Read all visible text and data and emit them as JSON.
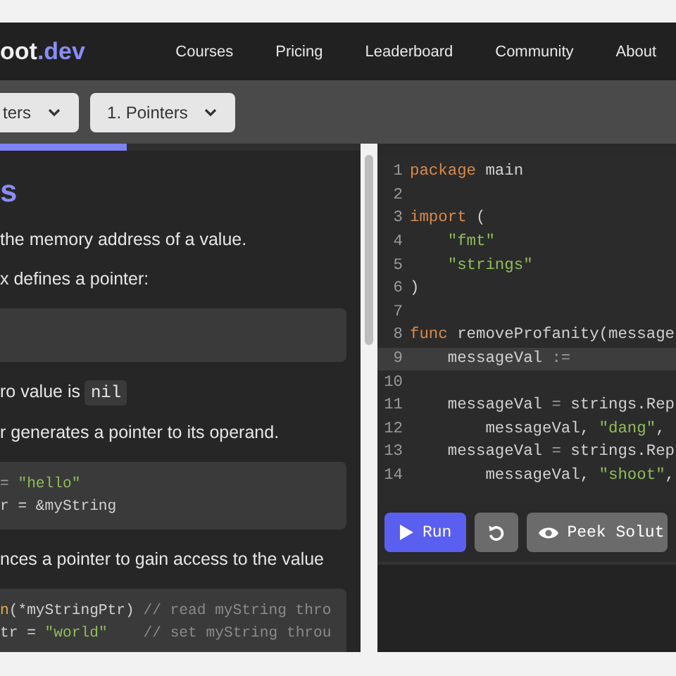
{
  "navbar": {
    "logo": {
      "name": "oot",
      "suffix": ".dev"
    },
    "links": [
      "Courses",
      "Pricing",
      "Leaderboard",
      "Community",
      "About"
    ]
  },
  "breadcrumbs": [
    {
      "label": "ters"
    },
    {
      "label": "1. Pointers"
    }
  ],
  "lesson": {
    "progress": {
      "level": 0.35
    },
    "heading": "s",
    "blocks": [
      {
        "kind": "text",
        "text": "the memory address of a value."
      },
      {
        "kind": "text",
        "text": "x defines a pointer:"
      },
      {
        "kind": "code"
      },
      {
        "kind": "text",
        "text": "ro value is",
        "code": "nil"
      },
      {
        "kind": "text",
        "text": "r generates a pointer to its operand."
      },
      {
        "kind": "code",
        "lines": [
          [
            {
              "text": "= ",
              "kind": "op"
            },
            {
              "text": "\"hello\"",
              "kind": "str"
            }
          ],
          [
            {
              "text": "r = &myString",
              "kind": "plain"
            }
          ]
        ]
      },
      {
        "kind": "text",
        "text": "nces a pointer to gain access to the value"
      },
      {
        "kind": "code",
        "lines": [
          [
            {
              "text": "n",
              "kind": "fn"
            },
            {
              "text": "(*myStringPtr) ",
              "kind": "plain"
            },
            {
              "text": "// read myString thro",
              "kind": "comment"
            }
          ],
          [
            {
              "text": "tr = ",
              "kind": "plain"
            },
            {
              "text": "\"world\"",
              "kind": "str"
            },
            {
              "text": "    // set myString throu",
              "kind": "comment"
            }
          ]
        ]
      }
    ]
  },
  "editor": {
    "lines": [
      {
        "number": "1",
        "active": false,
        "tokens": [
          {
            "text": "package ",
            "kind": "kw"
          },
          {
            "text": "main",
            "kind": "plain"
          }
        ]
      },
      {
        "number": "2",
        "active": false
      },
      {
        "number": "3",
        "active": false,
        "tokens": [
          {
            "text": "import ",
            "kind": "kw"
          },
          {
            "text": "(",
            "kind": "plain"
          }
        ]
      },
      {
        "number": "4",
        "active": false,
        "tokens": [
          {
            "text": "    \"fmt\"",
            "kind": "str"
          }
        ]
      },
      {
        "number": "5",
        "active": false,
        "tokens": [
          {
            "text": "    \"strings\"",
            "kind": "str"
          }
        ]
      },
      {
        "number": "6",
        "active": false,
        "tokens": [
          {
            "text": ")",
            "kind": "plain"
          }
        ]
      },
      {
        "number": "7",
        "active": false
      },
      {
        "number": "8",
        "active": false,
        "tokens": [
          {
            "text": "func ",
            "kind": "kw"
          },
          {
            "text": "removeProfanity(message",
            "kind": "plain"
          }
        ]
      },
      {
        "number": "9",
        "active": true,
        "tokens": [
          {
            "text": "    messageVal ",
            "kind": "plain"
          },
          {
            "text": ":=",
            "kind": "op"
          }
        ]
      },
      {
        "number": "10",
        "active": false
      },
      {
        "number": "11",
        "active": false,
        "tokens": [
          {
            "text": "    messageVal ",
            "kind": "plain"
          },
          {
            "text": "=",
            "kind": "op"
          },
          {
            "text": " strings.Rep",
            "kind": "plain"
          }
        ]
      },
      {
        "number": "12",
        "active": false,
        "tokens": [
          {
            "text": "        messageVal, ",
            "kind": "plain"
          },
          {
            "text": "\"dang\"",
            "kind": "str"
          },
          {
            "text": ",",
            "kind": "plain"
          }
        ]
      },
      {
        "number": "13",
        "active": false,
        "tokens": [
          {
            "text": "    messageVal ",
            "kind": "plain"
          },
          {
            "text": "=",
            "kind": "op"
          },
          {
            "text": " strings.Rep",
            "kind": "plain"
          }
        ]
      },
      {
        "number": "14",
        "active": false,
        "tokens": [
          {
            "text": "        messageVal, ",
            "kind": "plain"
          },
          {
            "text": "\"shoot\"",
            "kind": "str"
          },
          {
            "text": ",",
            "kind": "plain"
          }
        ]
      }
    ]
  },
  "actions": [
    {
      "kind": "run",
      "label": "Run"
    },
    {
      "kind": "reset"
    },
    {
      "kind": "peek",
      "label": "Peek Solut"
    }
  ]
}
